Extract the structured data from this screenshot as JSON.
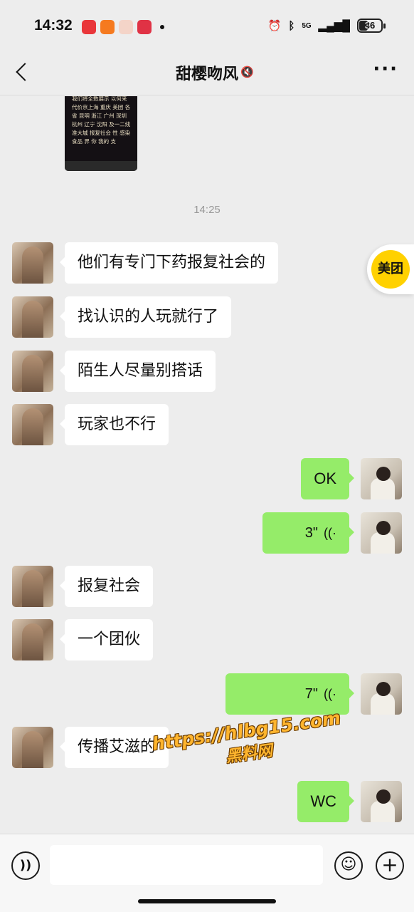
{
  "status": {
    "time": "14:32",
    "network": "5G",
    "battery": "36"
  },
  "nav": {
    "title": "甜樱吻风"
  },
  "chat": {
    "image_caption": "我们将全数展示 以何来代价京上海 重庆 美团 各省 昆明 浙江 广州 深圳 杭州 辽宁 沈阳 及一二线 准大城 报复社会 性 感染 食品 界 你 我的 支",
    "timestamp": "14:25",
    "messages": [
      {
        "side": "in",
        "text": "他们有专门下药报复社会的"
      },
      {
        "side": "in",
        "text": "找认识的人玩就行了"
      },
      {
        "side": "in",
        "text": "陌生人尽量别搭话"
      },
      {
        "side": "in",
        "text": "玩家也不行"
      },
      {
        "side": "out",
        "text": "OK"
      },
      {
        "side": "out",
        "voice": "3\""
      },
      {
        "side": "in",
        "text": "报复社会"
      },
      {
        "side": "in",
        "text": "一个团伙"
      },
      {
        "side": "out",
        "voice": "7\""
      },
      {
        "side": "in",
        "text": "传播艾滋的"
      },
      {
        "side": "out",
        "text": "WC"
      }
    ]
  },
  "floating": {
    "meituan_label": "美团"
  },
  "watermark": {
    "url": "https://hlbg15.com",
    "name": "黑料网"
  },
  "icons": {
    "back": "chevron-left-icon",
    "more": "more-dots-icon",
    "voice_input": "voice-wave-icon",
    "emoji": "emoji-smile-icon",
    "plus": "plus-icon"
  },
  "colors": {
    "outgoing_bubble": "#95ec69",
    "incoming_bubble": "#ffffff",
    "background": "#ededed",
    "meituan": "#ffd100"
  }
}
